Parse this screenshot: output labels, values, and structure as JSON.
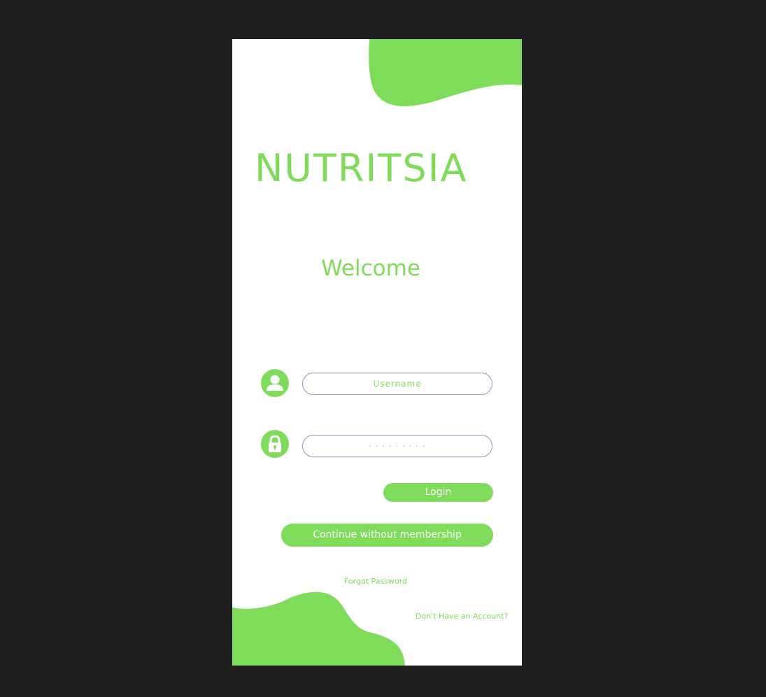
{
  "app": {
    "brand": "NUTRITSIA",
    "welcome": "Welcome"
  },
  "form": {
    "username": {
      "placeholder": "Username",
      "value": ""
    },
    "password": {
      "placeholder": "· · · · · · · · ·",
      "value": ""
    }
  },
  "actions": {
    "login_label": "Login",
    "continue_label": "Continue without membership",
    "forgot_label": "Forgot Password",
    "signup_label": "Don't Have an Account?"
  },
  "icons": {
    "user": "user-icon",
    "lock": "lock-icon"
  },
  "colors": {
    "accent": "#7fdb5a",
    "background": "#202020",
    "surface": "#ffffff",
    "field_border": "#8a9ab8"
  }
}
